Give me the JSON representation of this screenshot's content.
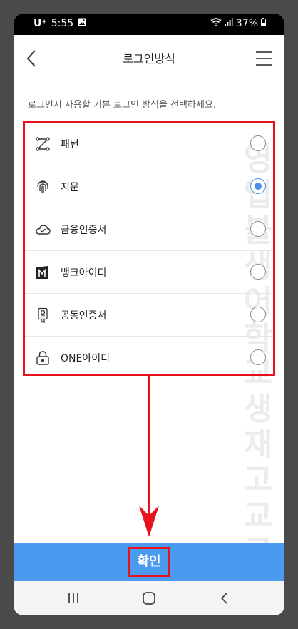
{
  "status_bar": {
    "carrier": "U⁺",
    "time": "5:55",
    "battery": "37%"
  },
  "header": {
    "title": "로그인방식"
  },
  "description": "로그인시 사용할 기본 로그인 방식을 선택하세요.",
  "options": [
    {
      "label": "패턴",
      "icon": "pattern-icon",
      "selected": false
    },
    {
      "label": "지문",
      "icon": "fingerprint-icon",
      "selected": true
    },
    {
      "label": "금융인증서",
      "icon": "cloud-check-icon",
      "selected": false
    },
    {
      "label": "뱅크아이디",
      "icon": "bank-id-icon",
      "selected": false
    },
    {
      "label": "공동인증서",
      "icon": "certificate-icon",
      "selected": false
    },
    {
      "label": "ONE아이디",
      "icon": "lock-icon",
      "selected": false
    }
  ],
  "watermark": "영업블생어학교생재고교료실",
  "confirm": {
    "label": "확인"
  },
  "colors": {
    "accent": "#4a9af0",
    "highlight": "#e8111e",
    "radio_selected": "#4a8fe8"
  }
}
